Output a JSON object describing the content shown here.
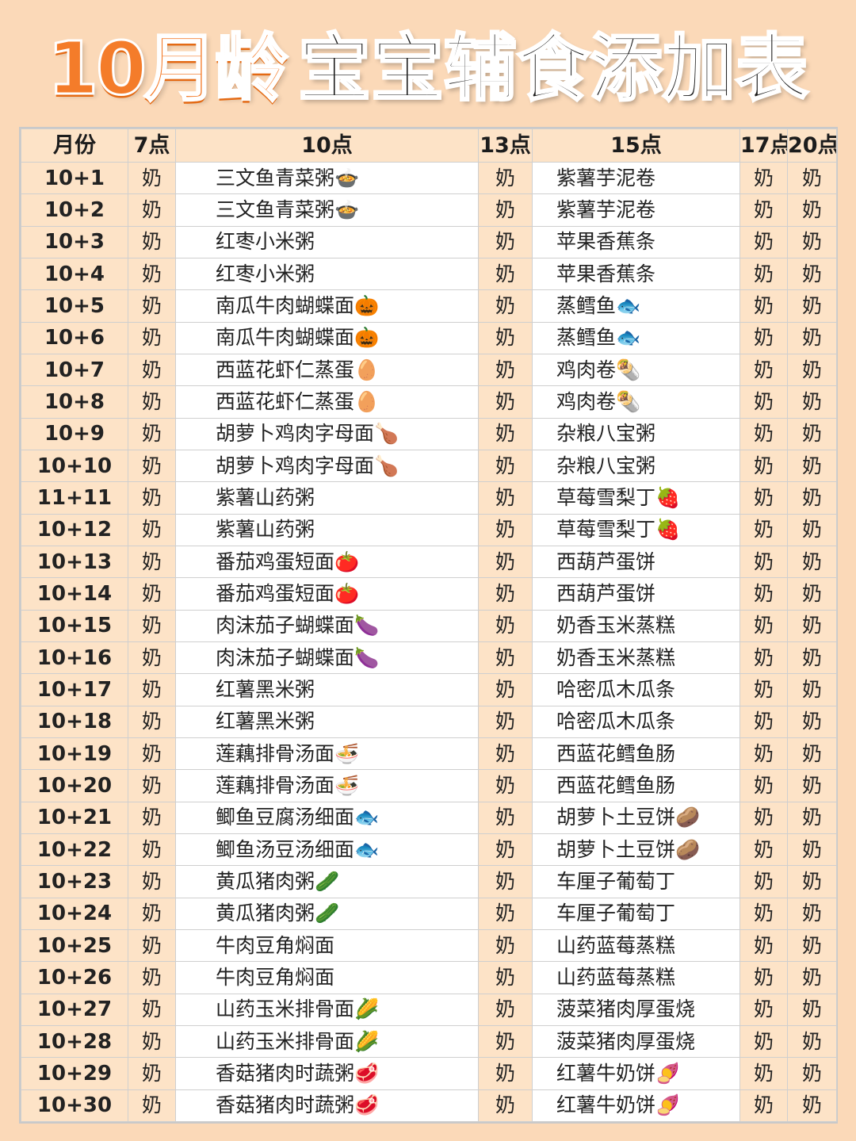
{
  "title": {
    "highlight": "10月龄",
    "main": "宝宝辅食添加表"
  },
  "headers": {
    "month": "月份",
    "t7": "7点",
    "t10": "10点",
    "t13": "13点",
    "t15": "15点",
    "t17": "17点",
    "t20": "20点"
  },
  "milk": "奶",
  "rows": [
    {
      "month": "10+1",
      "t10": "三文鱼青菜粥🍲",
      "t15": "紫薯芋泥卷"
    },
    {
      "month": "10+2",
      "t10": "三文鱼青菜粥🍲",
      "t15": "紫薯芋泥卷"
    },
    {
      "month": "10+3",
      "t10": "红枣小米粥",
      "t15": "苹果香蕉条"
    },
    {
      "month": "10+4",
      "t10": "红枣小米粥",
      "t15": "苹果香蕉条"
    },
    {
      "month": "10+5",
      "t10": "南瓜牛肉蝴蝶面🎃",
      "t15": "蒸鳕鱼🐟"
    },
    {
      "month": "10+6",
      "t10": "南瓜牛肉蝴蝶面🎃",
      "t15": "蒸鳕鱼🐟"
    },
    {
      "month": "10+7",
      "t10": "西蓝花虾仁蒸蛋🥚",
      "t15": "鸡肉卷🌯"
    },
    {
      "month": "10+8",
      "t10": "西蓝花虾仁蒸蛋🥚",
      "t15": "鸡肉卷🌯"
    },
    {
      "month": "10+9",
      "t10": "胡萝卜鸡肉字母面🍗",
      "t15": "杂粮八宝粥"
    },
    {
      "month": "10+10",
      "t10": "胡萝卜鸡肉字母面🍗",
      "t15": "杂粮八宝粥"
    },
    {
      "month": "11+11",
      "t10": "紫薯山药粥",
      "t15": "草莓雪梨丁🍓"
    },
    {
      "month": "10+12",
      "t10": "紫薯山药粥",
      "t15": "草莓雪梨丁🍓"
    },
    {
      "month": "10+13",
      "t10": "番茄鸡蛋短面🍅",
      "t15": "西葫芦蛋饼"
    },
    {
      "month": "10+14",
      "t10": "番茄鸡蛋短面🍅",
      "t15": "西葫芦蛋饼"
    },
    {
      "month": "10+15",
      "t10": "肉沫茄子蝴蝶面🍆",
      "t15": "奶香玉米蒸糕"
    },
    {
      "month": "10+16",
      "t10": "肉沫茄子蝴蝶面🍆",
      "t15": "奶香玉米蒸糕"
    },
    {
      "month": "10+17",
      "t10": "红薯黑米粥",
      "t15": "哈密瓜木瓜条"
    },
    {
      "month": "10+18",
      "t10": "红薯黑米粥",
      "t15": "哈密瓜木瓜条"
    },
    {
      "month": "10+19",
      "t10": "莲藕排骨汤面🍜",
      "t15": "西蓝花鳕鱼肠"
    },
    {
      "month": "10+20",
      "t10": "莲藕排骨汤面🍜",
      "t15": "西蓝花鳕鱼肠"
    },
    {
      "month": "10+21",
      "t10": "鲫鱼豆腐汤细面🐟",
      "t15": "胡萝卜土豆饼🥔"
    },
    {
      "month": "10+22",
      "t10": "鲫鱼汤豆汤细面🐟",
      "t15": "胡萝卜土豆饼🥔"
    },
    {
      "month": "10+23",
      "t10": "黄瓜猪肉粥🥒",
      "t15": "车厘子葡萄丁"
    },
    {
      "month": "10+24",
      "t10": "黄瓜猪肉粥🥒",
      "t15": "车厘子葡萄丁"
    },
    {
      "month": "10+25",
      "t10": "牛肉豆角焖面",
      "t15": "山药蓝莓蒸糕"
    },
    {
      "month": "10+26",
      "t10": "牛肉豆角焖面",
      "t15": "山药蓝莓蒸糕"
    },
    {
      "month": "10+27",
      "t10": "山药玉米排骨面🌽",
      "t15": "菠菜猪肉厚蛋烧"
    },
    {
      "month": "10+28",
      "t10": "山药玉米排骨面🌽",
      "t15": "菠菜猪肉厚蛋烧"
    },
    {
      "month": "10+29",
      "t10": "香菇猪肉时蔬粥🥩",
      "t15": "红薯牛奶饼🍠"
    },
    {
      "month": "10+30",
      "t10": "香菇猪肉时蔬粥🥩",
      "t15": "红薯牛奶饼🍠"
    }
  ],
  "colors": {
    "background": "#fbd9b8",
    "title_orange": "#f47c2a",
    "cell_tint": "#fde3c7"
  }
}
